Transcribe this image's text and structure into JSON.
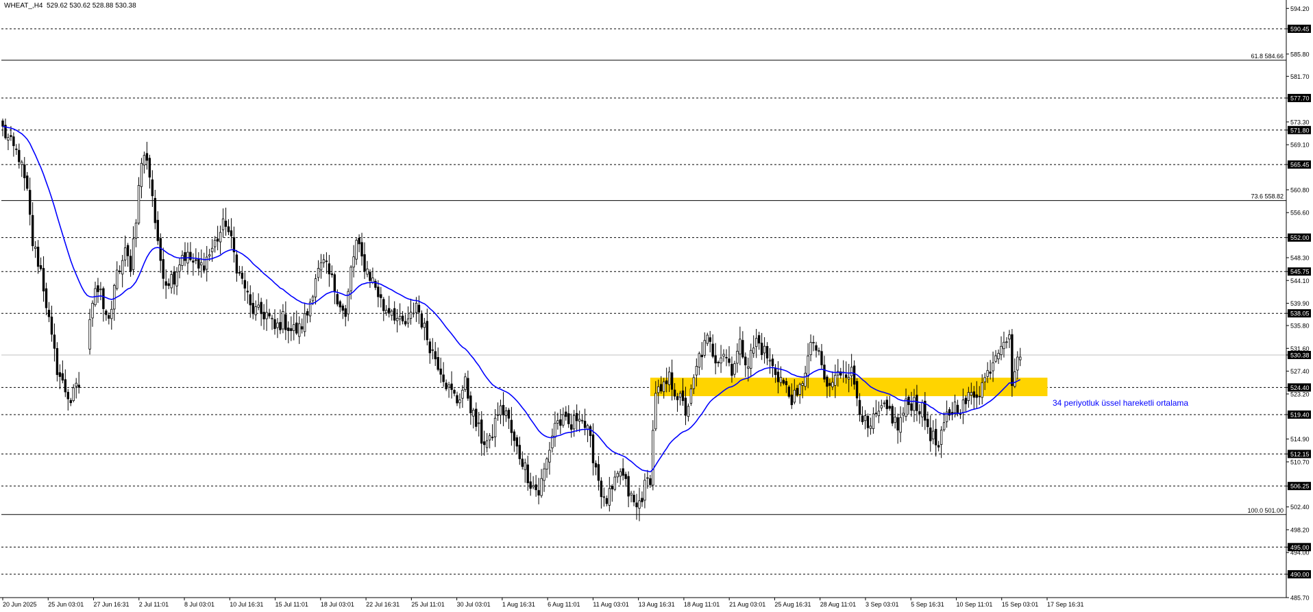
{
  "header": {
    "symbol": "WHEAT_,H4",
    "ohlc": "529.62 530.62 528.88 530.38"
  },
  "colors": {
    "background": "#ffffff",
    "candle": "#000000",
    "ema": "#0000ff",
    "zone": "#ffd400",
    "level_line": "#000000",
    "grid_dash": "#000000",
    "annotation_text": "#0000ff",
    "price_line": "#c0c0c0"
  },
  "icons": [],
  "chart_data": {
    "type": "candlestick",
    "title": "",
    "xlabel": "",
    "ylabel": "",
    "ylim": [
      485.7,
      595.5
    ],
    "y_ticks": [
      "594.20",
      "590.45",
      "585.80",
      "581.70",
      "577.70",
      "573.30",
      "571.80",
      "569.10",
      "565.45",
      "560.80",
      "556.60",
      "552.00",
      "548.30",
      "545.75",
      "544.10",
      "539.90",
      "538.05",
      "535.80",
      "531.60",
      "530.38",
      "527.40",
      "524.40",
      "523.20",
      "519.40",
      "514.90",
      "512.15",
      "510.70",
      "506.25",
      "502.40",
      "498.20",
      "495.00",
      "494.00",
      "490.00",
      "485.70"
    ],
    "x_ticks": [
      "20 Jun 2025",
      "25 Jun 03:01",
      "27 Jun 16:31",
      "2 Jul 11:01",
      "8 Jul 03:01",
      "10 Jul 16:31",
      "15 Jul 11:01",
      "18 Jul 03:01",
      "22 Jul 16:31",
      "25 Jul 11:01",
      "30 Jul 03:01",
      "1 Aug 16:31",
      "6 Aug 11:01",
      "11 Aug 03:01",
      "13 Aug 16:31",
      "18 Aug 11:01",
      "21 Aug 03:01",
      "25 Aug 16:31",
      "28 Aug 11:01",
      "3 Sep 03:01",
      "5 Sep 16:31",
      "10 Sep 11:01",
      "15 Sep 03:01",
      "17 Sep 16:31"
    ],
    "dashed_levels": [
      {
        "value": 590.45,
        "label": "590.45"
      },
      {
        "value": 577.7,
        "label": "577.70"
      },
      {
        "value": 571.8,
        "label": "571.80"
      },
      {
        "value": 565.45,
        "label": "565.45"
      },
      {
        "value": 552.0,
        "label": "552.00"
      },
      {
        "value": 545.75,
        "label": "545.75"
      },
      {
        "value": 538.05,
        "label": "538.05"
      },
      {
        "value": 524.4,
        "label": "524.40"
      },
      {
        "value": 519.4,
        "label": "519.40"
      },
      {
        "value": 512.15,
        "label": "512.15"
      },
      {
        "value": 506.25,
        "label": "506.25"
      },
      {
        "value": 495.0,
        "label": "495.00"
      },
      {
        "value": 490.0,
        "label": "490.00"
      }
    ],
    "fib_levels": [
      {
        "value": 584.66,
        "label": "61.8 584.66"
      },
      {
        "value": 558.82,
        "label": "73.6 558.82"
      },
      {
        "value": 501.0,
        "label": "100.0 501.00"
      }
    ],
    "current_price": {
      "value": 530.38,
      "label": "530.38"
    },
    "zone": {
      "from": 522.8,
      "to": 526.2,
      "start_index": 238,
      "end_index": 384
    },
    "annotation": "34 periyotluk üssel hareketli ortalama",
    "ema_period": 34,
    "anchors": [
      [
        0,
        572
      ],
      [
        3,
        569
      ],
      [
        6,
        567
      ],
      [
        9,
        560
      ],
      [
        11,
        551
      ],
      [
        14,
        546
      ],
      [
        16,
        540
      ],
      [
        18,
        533
      ],
      [
        20,
        528
      ],
      [
        22,
        525
      ],
      [
        25,
        522
      ],
      [
        27,
        524
      ],
      [
        30,
        526
      ],
      [
        32,
        538
      ],
      [
        34,
        543
      ],
      [
        36,
        541
      ],
      [
        38,
        537
      ],
      [
        40,
        539
      ],
      [
        42,
        545
      ],
      [
        45,
        549
      ],
      [
        47,
        547
      ],
      [
        49,
        556
      ],
      [
        51,
        566
      ],
      [
        53,
        567
      ],
      [
        55,
        560
      ],
      [
        57,
        550
      ],
      [
        60,
        544
      ],
      [
        63,
        545
      ],
      [
        66,
        549
      ],
      [
        69,
        548
      ],
      [
        72,
        546
      ],
      [
        76,
        549
      ],
      [
        79,
        552
      ],
      [
        82,
        555
      ],
      [
        85,
        549
      ],
      [
        87,
        545
      ],
      [
        89,
        543
      ],
      [
        91,
        539
      ],
      [
        94,
        538
      ],
      [
        97,
        538
      ],
      [
        100,
        535
      ],
      [
        103,
        537
      ],
      [
        106,
        535
      ],
      [
        109,
        535
      ],
      [
        112,
        538
      ],
      [
        115,
        545
      ],
      [
        118,
        547
      ],
      [
        121,
        544
      ],
      [
        124,
        540
      ],
      [
        126,
        537
      ],
      [
        128,
        546
      ],
      [
        130,
        551
      ],
      [
        132,
        548
      ],
      [
        134,
        546
      ],
      [
        137,
        543
      ],
      [
        140,
        539
      ],
      [
        143,
        539
      ],
      [
        146,
        536
      ],
      [
        149,
        536
      ],
      [
        152,
        540
      ],
      [
        155,
        535
      ],
      [
        158,
        531
      ],
      [
        161,
        528
      ],
      [
        164,
        524
      ],
      [
        167,
        522
      ],
      [
        170,
        525
      ],
      [
        173,
        519
      ],
      [
        176,
        515
      ],
      [
        179,
        514
      ],
      [
        182,
        520
      ],
      [
        185,
        520
      ],
      [
        188,
        514
      ],
      [
        191,
        511
      ],
      [
        194,
        507
      ],
      [
        197,
        505
      ],
      [
        200,
        511
      ],
      [
        203,
        518
      ],
      [
        206,
        518
      ],
      [
        209,
        517
      ],
      [
        212,
        520
      ],
      [
        215,
        516
      ],
      [
        218,
        510
      ],
      [
        221,
        503
      ],
      [
        224,
        505
      ],
      [
        227,
        509
      ],
      [
        230,
        505
      ],
      [
        233,
        502
      ],
      [
        236,
        506
      ],
      [
        238,
        508
      ],
      [
        240,
        524
      ],
      [
        242,
        523
      ],
      [
        245,
        526
      ],
      [
        248,
        523
      ],
      [
        251,
        520
      ],
      [
        253,
        523
      ],
      [
        256,
        530
      ],
      [
        259,
        533
      ],
      [
        262,
        530
      ],
      [
        265,
        531
      ],
      [
        268,
        528
      ],
      [
        271,
        532
      ],
      [
        274,
        529
      ],
      [
        277,
        533
      ],
      [
        280,
        531
      ],
      [
        283,
        528
      ],
      [
        286,
        526
      ],
      [
        289,
        523
      ],
      [
        292,
        522
      ],
      [
        295,
        528
      ],
      [
        298,
        533
      ],
      [
        301,
        528
      ],
      [
        303,
        524
      ],
      [
        306,
        526
      ],
      [
        309,
        528
      ],
      [
        312,
        527
      ],
      [
        315,
        521
      ],
      [
        318,
        516
      ],
      [
        320,
        518
      ],
      [
        323,
        520
      ],
      [
        326,
        520
      ],
      [
        329,
        517
      ],
      [
        332,
        521
      ],
      [
        335,
        522
      ],
      [
        338,
        520
      ],
      [
        341,
        516
      ],
      [
        344,
        513
      ],
      [
        347,
        519
      ],
      [
        350,
        521
      ],
      [
        353,
        521
      ],
      [
        356,
        523
      ],
      [
        359,
        524
      ],
      [
        362,
        527
      ],
      [
        365,
        531
      ],
      [
        368,
        534
      ],
      [
        370,
        533
      ],
      [
        371,
        526
      ],
      [
        374,
        530
      ]
    ]
  }
}
